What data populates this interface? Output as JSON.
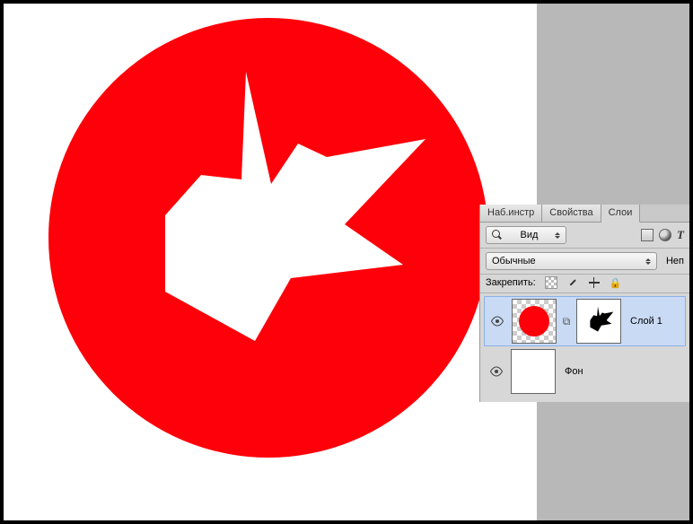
{
  "panel": {
    "tabs": [
      "Наб.инстр",
      "Свойства",
      "Слои"
    ],
    "active_tab": 2,
    "filter_label": "Вид",
    "blend_mode": "Обычные",
    "opacity_label": "Неп",
    "lock_label": "Закрепить:"
  },
  "layers": [
    {
      "name": "Слой 1",
      "visible": true,
      "selected": true,
      "has_mask": true
    },
    {
      "name": "Фон",
      "visible": true,
      "selected": false,
      "has_mask": false
    }
  ],
  "colors": {
    "accent": "#fe0009"
  }
}
